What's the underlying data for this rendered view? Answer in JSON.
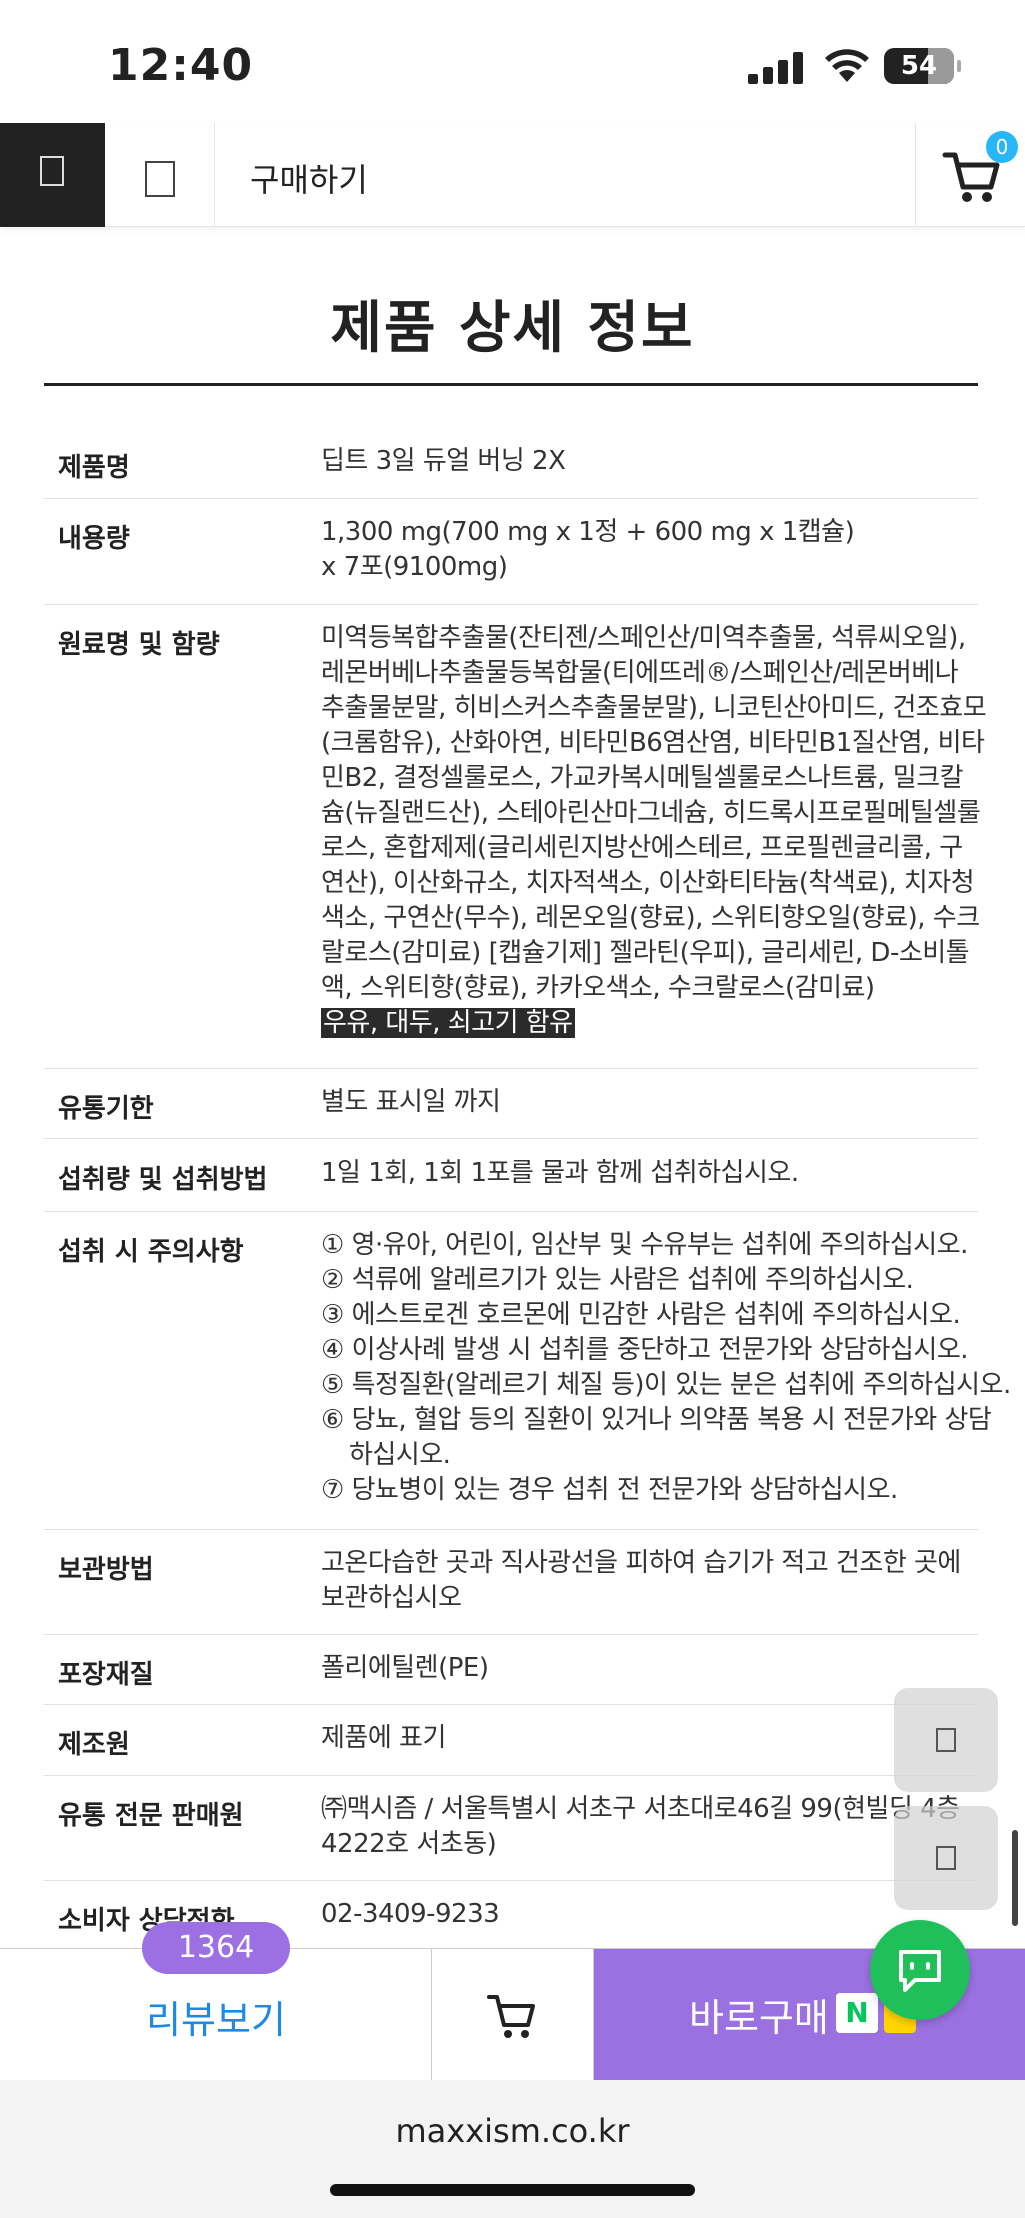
{
  "status": {
    "time": "12:40",
    "battery": "54"
  },
  "nav": {
    "title": "구매하기",
    "cart_count": "0"
  },
  "heading": "제품 상세 정보",
  "rows": [
    {
      "label": "제품명",
      "lines": [
        "딥트 3일 듀얼 버닝 2X"
      ]
    },
    {
      "label": "내용량",
      "lines": [
        "1,300 mg(700 mg x 1정 + 600 mg x 1캡슐)",
        "x 7포(9100mg)"
      ]
    },
    {
      "label": "원료명 및 함량",
      "lines": [
        "미역등복합추출물(잔티젠/스페인산/미역추출물, 석류씨오일),",
        "레몬버베나추출물등복합물(티에뜨레®/스페인산/레몬버베나",
        "추출물분말, 히비스커스추출물분말), 니코틴산아미드, 건조효모",
        "(크롬함유), 산화아연, 비타민B6염산염, 비타민B1질산염, 비타",
        "민B2, 결정셀룰로스, 가교카복시메틸셀룰로스나트륨, 밀크칼",
        "슘(뉴질랜드산), 스테아린산마그네슘, 히드록시프로필메틸셀룰",
        "로스, 혼합제제(글리세린지방산에스테르, 프로필렌글리콜, 구",
        "연산), 이산화규소, 치자적색소, 이산화티타늄(착색료), 치자청",
        "색소, 구연산(무수), 레몬오일(향료), 스위티향오일(향료), 수크",
        "랄로스(감미료) [캡슐기제] 젤라틴(우피), 글리세린, D-소비톨",
        "액, 스위티향(향료), 카카오색소, 수크랄로스(감미료)"
      ],
      "allergy": "우유, 대두, 쇠고기 함유"
    },
    {
      "label": "유통기한",
      "lines": [
        "별도 표시일 까지"
      ]
    },
    {
      "label": "섭취량 및 섭취방법",
      "lines": [
        "1일 1회, 1회 1포를 물과 함께 섭취하십시오."
      ]
    },
    {
      "label": "섭취 시 주의사항",
      "lines": [
        "① 영·유아, 어린이, 임산부 및 수유부는 섭취에 주의하십시오.",
        "② 석류에 알레르기가 있는 사람은 섭취에 주의하십시오.",
        "③ 에스트로겐 호르몬에 민감한 사람은 섭취에 주의하십시오.",
        "④ 이상사례 발생 시 섭취를 중단하고 전문가와 상담하십시오.",
        "⑤ 특정질환(알레르기 체질 등)이 있는 분은 섭취에 주의하십시오.",
        "⑥ 당뇨, 혈압 등의 질환이 있거나 의약품 복용 시 전문가와 상담",
        "하십시오.",
        "⑦ 당뇨병이 있는 경우 섭취 전 전문가와 상담하십시오."
      ]
    },
    {
      "label": "보관방법",
      "lines": [
        "고온다습한 곳과 직사광선을 피하여 습기가 적고 건조한 곳에",
        "보관하십시오"
      ]
    },
    {
      "label": "포장재질",
      "lines": [
        "폴리에틸렌(PE)"
      ]
    },
    {
      "label": "제조원",
      "lines": [
        "제품에 표기"
      ]
    },
    {
      "label": "유통 전문 판매원",
      "lines": [
        "㈜맥시즘 / 서울특별시 서초구 서초대로46길 99(현빌딩 4층",
        "4222호 서초동)"
      ]
    },
    {
      "label": "소비자 상담전화",
      "lines": [
        "02-3409-9233"
      ]
    }
  ],
  "bottom": {
    "review_label": "리뷰보기",
    "review_count": "1364",
    "buy_label": "바로구매",
    "naver_badge": "N"
  },
  "url": "maxxism.co.kr"
}
